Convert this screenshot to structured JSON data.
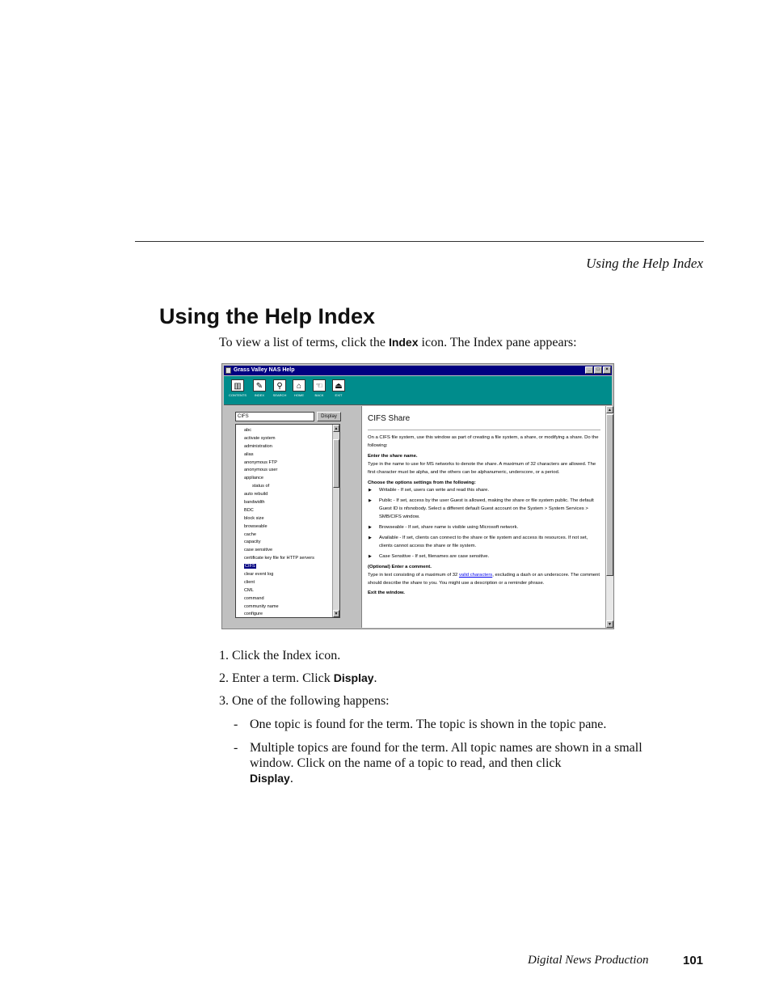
{
  "running_header": "Using the Help Index",
  "heading": "Using the Help Index",
  "intro": {
    "before": "To view a list of terms, click the ",
    "bold": "Index",
    "after": " icon. The Index pane appears:"
  },
  "screenshot": {
    "window_title": "Grass Valley NAS Help",
    "window_controls": [
      "_",
      "□",
      "×"
    ],
    "toolbar": [
      {
        "label": "CONTENTS",
        "icon": "contents-icon",
        "glyph": "▥"
      },
      {
        "label": "INDEX",
        "icon": "index-icon",
        "glyph": "✎"
      },
      {
        "label": "SEARCH",
        "icon": "search-icon",
        "glyph": "⚲"
      },
      {
        "label": "HOME",
        "icon": "home-icon",
        "glyph": "⌂"
      },
      {
        "label": "BACK",
        "icon": "back-icon",
        "glyph": "☜"
      },
      {
        "label": "EXIT",
        "icon": "exit-icon",
        "glyph": "⏏"
      }
    ],
    "search_value": "CIFS",
    "display_button": "Display",
    "index_items": [
      {
        "text": "abc",
        "sub": false,
        "selected": false
      },
      {
        "text": "activate system",
        "sub": false,
        "selected": false
      },
      {
        "text": "administration",
        "sub": false,
        "selected": false
      },
      {
        "text": "alias",
        "sub": false,
        "selected": false
      },
      {
        "text": "anonymous FTP",
        "sub": false,
        "selected": false
      },
      {
        "text": "anonymous user",
        "sub": false,
        "selected": false
      },
      {
        "text": "appliance",
        "sub": false,
        "selected": false
      },
      {
        "text": "status of",
        "sub": true,
        "selected": false
      },
      {
        "text": "auto rebuild",
        "sub": false,
        "selected": false
      },
      {
        "text": "bandwidth",
        "sub": false,
        "selected": false
      },
      {
        "text": "BDC",
        "sub": false,
        "selected": false
      },
      {
        "text": "block size",
        "sub": false,
        "selected": false
      },
      {
        "text": "browseable",
        "sub": false,
        "selected": false
      },
      {
        "text": "cache",
        "sub": false,
        "selected": false
      },
      {
        "text": "capacity",
        "sub": false,
        "selected": false
      },
      {
        "text": "case sensitive",
        "sub": false,
        "selected": false
      },
      {
        "text": "certificate key file for HTTP servers",
        "sub": false,
        "selected": false
      },
      {
        "text": "CIFS",
        "sub": false,
        "selected": true
      },
      {
        "text": "clear event log",
        "sub": false,
        "selected": false
      },
      {
        "text": "client",
        "sub": false,
        "selected": false
      },
      {
        "text": "CML",
        "sub": false,
        "selected": false
      },
      {
        "text": "command",
        "sub": false,
        "selected": false
      },
      {
        "text": "community name",
        "sub": false,
        "selected": false
      },
      {
        "text": "configure",
        "sub": false,
        "selected": false
      }
    ],
    "topic": {
      "title": "CIFS Share",
      "p1": "On a CIFS file system, use this window as part of creating a file system, a share, or modifying a share. Do the following:",
      "h1": "Enter the share name.",
      "p2": "Type in the name to use for MS networks to denote the share. A maximum of 32 characters are allowed. The first character must be alpha, and the others can be alphanumeric, underscore, or a period.",
      "h2": "Choose the options settings from the following:",
      "bullets": [
        "Writable - If set, users can write and read this share.",
        "Public - If set, access by the user Guest is allowed, making the share or file system public. The default Guest ID is nfsnobody. Select a different default Guest account on the System > System Services > SMB/CIFS window.",
        "Browseable - If set, share name is visible using Microsoft network.",
        "Available - If set, clients can connect to the share or file system and access its resources. If not set, clients cannot access the share or file system.",
        "Case Sensitive - If set, filenames are case sensitive."
      ],
      "h3": "(Optional) Enter a comment.",
      "p3_before": "Type in text consisting of a maximum of 32 ",
      "p3_link": "valid characters",
      "p3_after": ", excluding a dash or an underscore. The comment should describe the share to you. You might use a description or a reminder phrase.",
      "h4": "Exit the window."
    }
  },
  "steps": [
    {
      "num": "1.",
      "before": "Click the Index icon.",
      "bold": "",
      "after": ""
    },
    {
      "num": "2.",
      "before": "Enter a term. Click ",
      "bold": "Display",
      "after": "."
    },
    {
      "num": "3.",
      "before": "One of the following happens:",
      "bold": "",
      "after": ""
    }
  ],
  "substeps": [
    {
      "dash": "-",
      "before": "One topic is found for the term. The topic is shown in the topic pane.",
      "bold": "",
      "after": ""
    },
    {
      "dash": "-",
      "before": "Multiple topics are found for the term. All topic names are shown in a small window. Click on the name of a topic to read, and then click ",
      "bold": "Display",
      "after": "."
    }
  ],
  "footer": {
    "title": "Digital News Production",
    "page": "101"
  }
}
